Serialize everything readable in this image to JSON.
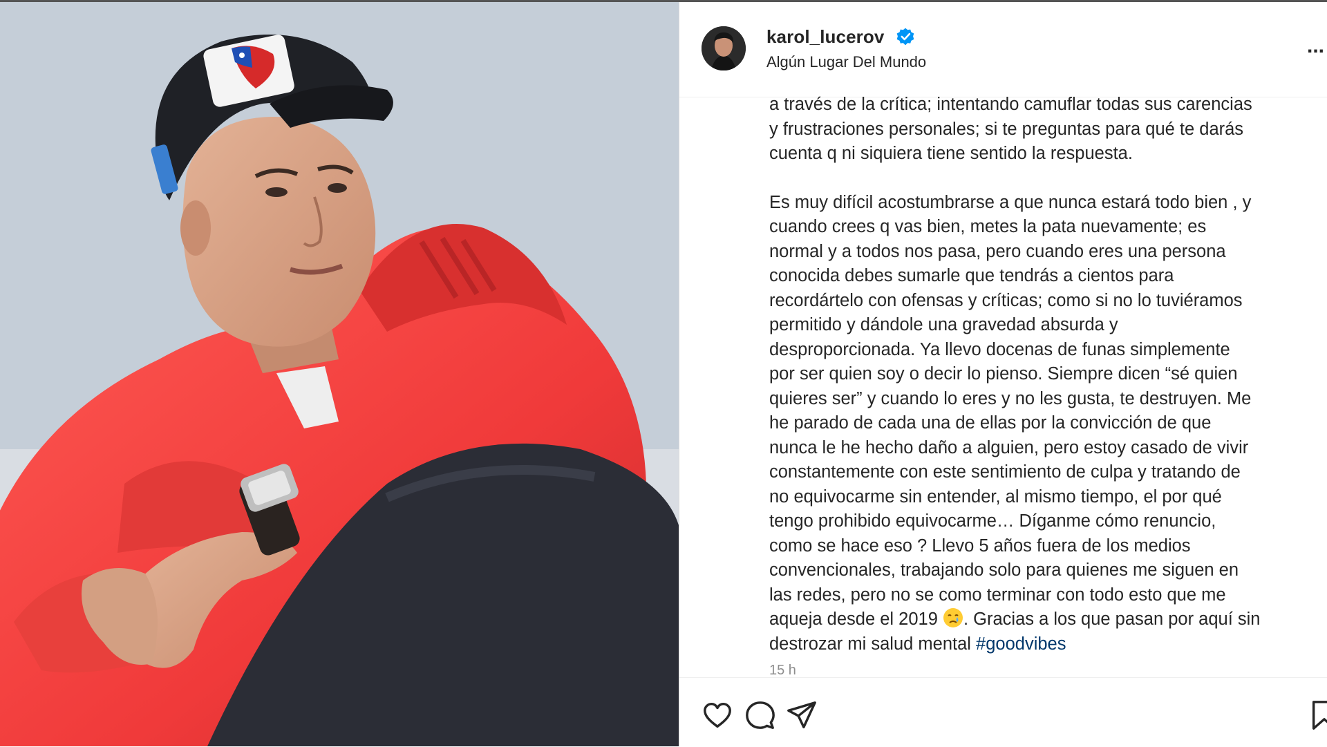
{
  "post": {
    "username": "karol_lucerov",
    "verified": true,
    "location": "Algún Lugar Del Mundo",
    "more_label": "...",
    "caption": {
      "paragraph1": "a través de la crítica; intentando camuflar todas sus carencias\ny frustraciones personales; si te preguntas para qué te darás\ncuenta q ni siquiera tiene sentido la respuesta.",
      "paragraph2": "Es muy difícil acostumbrarse a que nunca estará todo bien , y\ncuando crees q vas bien, metes la pata nuevamente; es\nnormal y a todos nos pasa, pero cuando eres una persona\nconocida debes sumarle que tendrás a cientos para\nrecordártelo con ofensas y críticas; como si no lo tuviéramos\npermitido y dándole una gravedad absurda y\ndesproporcionada. Ya llevo docenas de funas simplemente\npor ser quien soy o decir lo pienso. Siempre dicen “sé quien\nquieres ser” y cuando lo eres y no les gusta, te destruyen. Me\nhe parado de cada una de ellas por la convicción de que\nnunca le he hecho daño a alguien, pero estoy casado de vivir\nconstantemente con este sentimiento de culpa y tratando de\nno equivocarme sin entender, al mismo tiempo, el por qué\ntengo prohibido equivocarme… Díganme cómo renuncio,\ncomo se hace eso ? Llevo 5 años fuera de los medios\nconvencionales, trabajando solo para quienes me siguen en\nlas redes, pero no se como terminar con todo esto que me\naqueja desde el 2019",
      "paragraph2_end": ". Gracias a los que pasan por aquí sin\ndestrozar mi salud mental ",
      "hashtag": "#goodvibes"
    },
    "timestamp": "15 h"
  },
  "icons": {
    "verified": "verified-badge-icon",
    "like": "heart-icon",
    "comment": "comment-bubble-icon",
    "share": "paper-plane-icon",
    "save": "bookmark-icon",
    "emoji": "crying-face-emoji",
    "more": "more-options-icon"
  },
  "colors": {
    "accent_blue": "#0095f6",
    "hashtag": "#00376b",
    "text": "#262626",
    "muted": "#8e8e8e",
    "hoodie_red": "#f0423f"
  }
}
